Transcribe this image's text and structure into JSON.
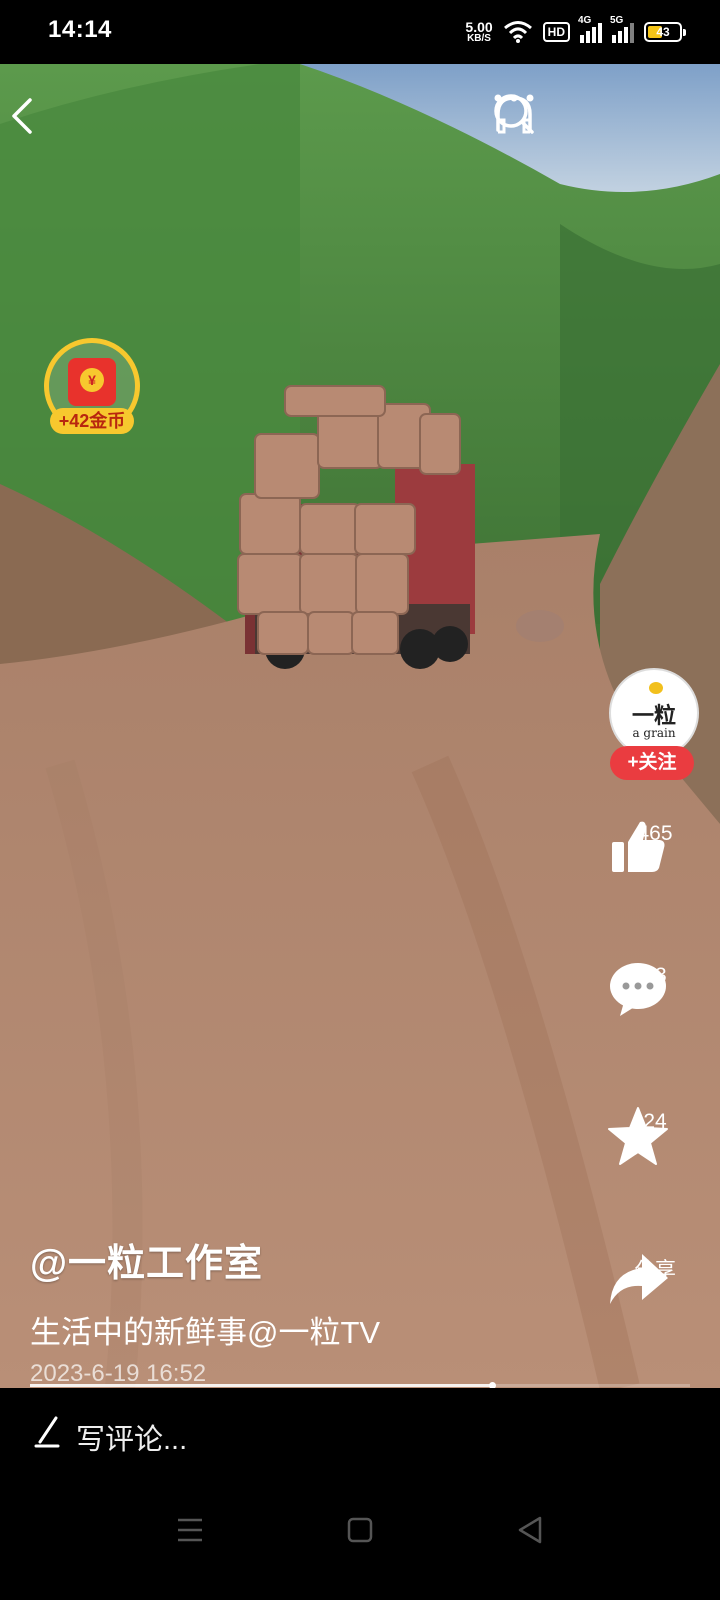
{
  "status_bar": {
    "time": "14:14",
    "net_speed_value": "5.00",
    "net_speed_unit": "KB/S",
    "hd_label": "HD",
    "sim1_label": "4G",
    "sim2_label": "5G",
    "battery_level": "43",
    "icons": [
      "wifi-icon",
      "signal-icon",
      "battery-icon"
    ]
  },
  "header": {
    "icons": [
      "back-icon",
      "search-icon",
      "headphones-icon",
      "more-icon"
    ]
  },
  "reward": {
    "label": "+42金币",
    "coin_symbol": "¥",
    "colors": {
      "ring": "#f7c82e",
      "bag": "#e8322c"
    }
  },
  "author_profile": {
    "avatar_big": "一粒",
    "avatar_small": "a grain",
    "follow_label": "+关注",
    "follow_color": "#ea3c40"
  },
  "actions": {
    "like_count": "465",
    "comment_count": "63",
    "favorite_count": "24",
    "share_label": "分享"
  },
  "video": {
    "author": "@一粒工作室",
    "description": "生活中的新鲜事@一粒TV",
    "date": "2023-6-19 16:52",
    "progress": 0.7
  },
  "comment_bar": {
    "placeholder": "写评论..."
  },
  "nav_bar": {
    "icons": [
      "menu-icon",
      "home-icon",
      "back-triangle-icon"
    ]
  }
}
